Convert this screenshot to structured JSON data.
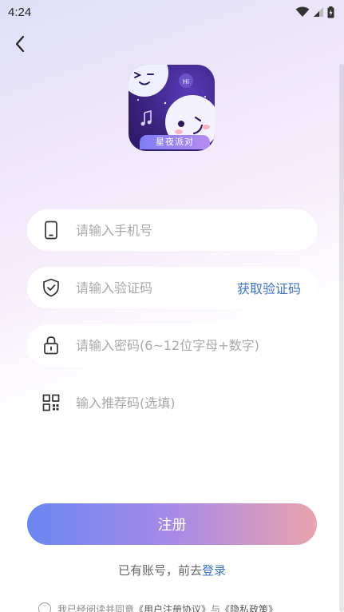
{
  "status_bar": {
    "time": "4:24"
  },
  "logo": {
    "label": "星夜派对",
    "bubble_text": "Hi"
  },
  "form": {
    "phone_placeholder": "请输入手机号",
    "code_placeholder": "请输入验证码",
    "get_code_label": "获取验证码",
    "password_placeholder": "请输入密码(6~12位字母+数字)",
    "referral_placeholder": "输入推荐码(选填)"
  },
  "register": {
    "label": "注册"
  },
  "login": {
    "prompt": "已有账号，前去",
    "link": "登录"
  },
  "agreement": {
    "prefix": "我已经阅读并同意",
    "user_agreement": "《用户注册协议》",
    "conjunction": "与",
    "privacy_policy": "《隐私政策》"
  }
}
